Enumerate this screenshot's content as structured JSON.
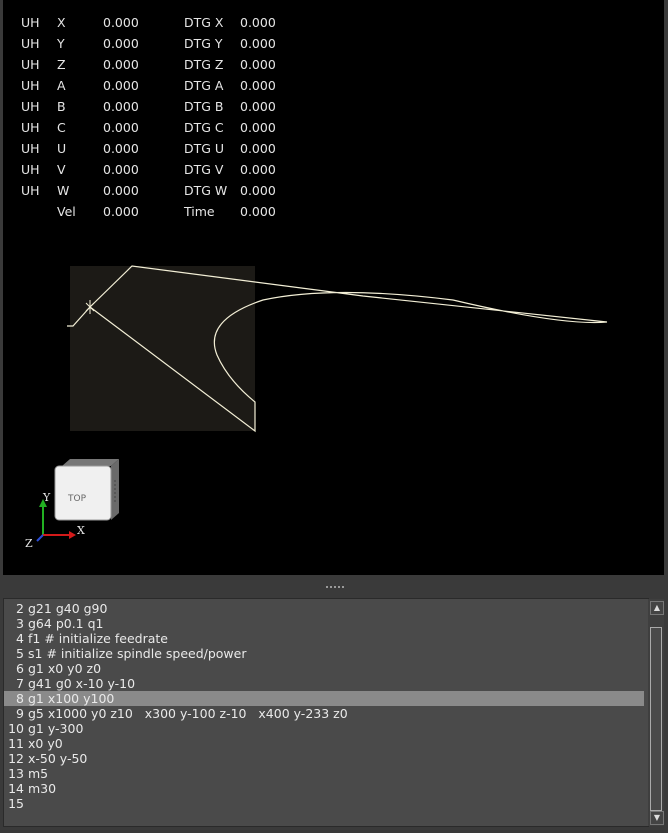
{
  "dro": {
    "rows": [
      {
        "homed": "UH",
        "axis": "X",
        "pos": "0.000",
        "dtg_label": "DTG X",
        "dtg": "0.000"
      },
      {
        "homed": "UH",
        "axis": "Y",
        "pos": "0.000",
        "dtg_label": "DTG Y",
        "dtg": "0.000"
      },
      {
        "homed": "UH",
        "axis": "Z",
        "pos": "0.000",
        "dtg_label": "DTG Z",
        "dtg": "0.000"
      },
      {
        "homed": "UH",
        "axis": "A",
        "pos": "0.000",
        "dtg_label": "DTG A",
        "dtg": "0.000"
      },
      {
        "homed": "UH",
        "axis": "B",
        "pos": "0.000",
        "dtg_label": "DTG B",
        "dtg": "0.000"
      },
      {
        "homed": "UH",
        "axis": "C",
        "pos": "0.000",
        "dtg_label": "DTG C",
        "dtg": "0.000"
      },
      {
        "homed": "UH",
        "axis": "U",
        "pos": "0.000",
        "dtg_label": "DTG U",
        "dtg": "0.000"
      },
      {
        "homed": "UH",
        "axis": "V",
        "pos": "0.000",
        "dtg_label": "DTG V",
        "dtg": "0.000"
      },
      {
        "homed": "UH",
        "axis": "W",
        "pos": "0.000",
        "dtg_label": "DTG W",
        "dtg": "0.000"
      }
    ],
    "vel_label": "Vel",
    "vel": "0.000",
    "time_label": "Time",
    "time": "0.000"
  },
  "view": {
    "cube_label": "TOP",
    "axis_x": "X",
    "axis_y": "Y",
    "axis_z": "Z",
    "colors": {
      "background": "#000000",
      "extents_box": "#1c1a16",
      "toolpath": "#f3efd6",
      "axis_x": "#d41a1a",
      "axis_y": "#22b022",
      "axis_z": "#2a4cd4"
    }
  },
  "gcode": {
    "current_line": 8,
    "lines": [
      {
        "n": "2",
        "text": "g21 g40 g90"
      },
      {
        "n": "3",
        "text": "g64 p0.1 q1"
      },
      {
        "n": "4",
        "text": "f1 # initialize feedrate"
      },
      {
        "n": "5",
        "text": "s1 # initialize spindle speed/power"
      },
      {
        "n": "6",
        "text": "g1 x0 y0 z0"
      },
      {
        "n": "7",
        "text": "g41 g0 x-10 y-10"
      },
      {
        "n": "8",
        "text": "g1 x100 y100"
      },
      {
        "n": "9",
        "text": "g5 x1000 y0 z10   x300 y-100 z-10   x400 y-233 z0"
      },
      {
        "n": "10",
        "text": "g1 y-300"
      },
      {
        "n": "11",
        "text": "x0 y0"
      },
      {
        "n": "12",
        "text": "x-50 y-50"
      },
      {
        "n": "13",
        "text": "m5"
      },
      {
        "n": "14",
        "text": "m30"
      },
      {
        "n": "15",
        "text": ""
      }
    ]
  }
}
